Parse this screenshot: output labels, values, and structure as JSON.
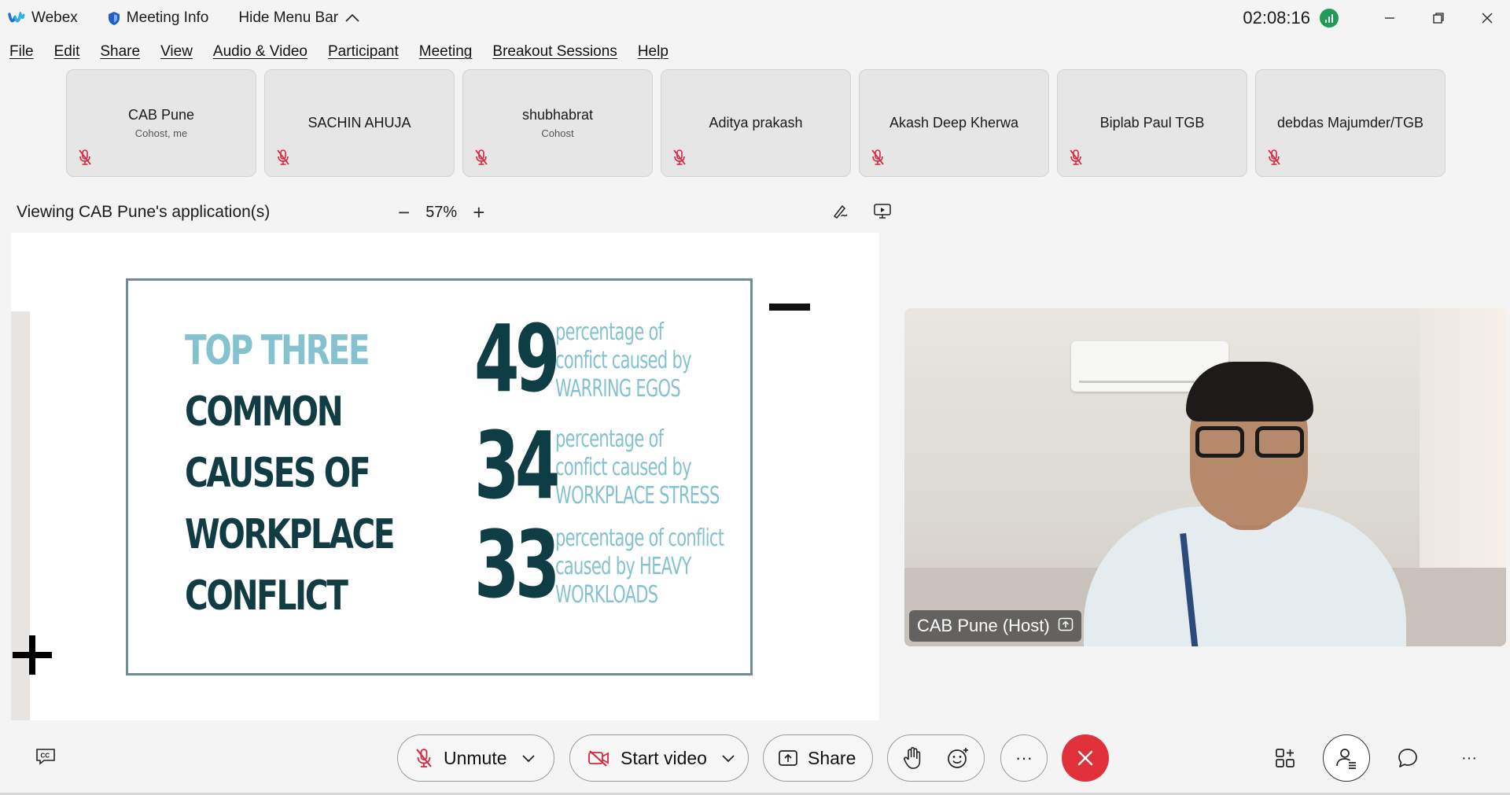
{
  "titlebar": {
    "app_name": "Webex",
    "meeting_info": "Meeting Info",
    "hide_menu": "Hide Menu Bar",
    "time": "02:08:16"
  },
  "menu": [
    "File",
    "Edit",
    "Share",
    "View",
    "Audio & Video",
    "Participant",
    "Meeting",
    "Breakout Sessions",
    "Help"
  ],
  "participants": [
    {
      "name": "CAB Pune",
      "role": "Cohost, me"
    },
    {
      "name": "SACHIN AHUJA",
      "role": ""
    },
    {
      "name": "shubhabrat",
      "role": "Cohost"
    },
    {
      "name": "Aditya prakash",
      "role": ""
    },
    {
      "name": "Akash Deep Kherwa",
      "role": ""
    },
    {
      "name": "Biplab Paul TGB",
      "role": ""
    },
    {
      "name": "debdas Majumder/TGB",
      "role": ""
    }
  ],
  "share_view": {
    "title": "Viewing CAB Pune's application(s)",
    "zoom": "57%",
    "zoom_out": "−",
    "zoom_in": "+"
  },
  "slide": {
    "title_lines": [
      {
        "text": "TOP THREE",
        "tone": "light"
      },
      {
        "text": "COMMON",
        "tone": "dark"
      },
      {
        "text": "CAUSES OF",
        "tone": "dark"
      },
      {
        "text": "WORKPLACE",
        "tone": "dark"
      },
      {
        "text": "CONFLICT",
        "tone": "dark"
      }
    ],
    "stats": [
      {
        "value": "49",
        "lines": [
          "percentage of",
          "confict caused by",
          "WARRING EGOS"
        ]
      },
      {
        "value": "34",
        "lines": [
          "percentage of",
          "confict caused by",
          "WORKPLACE STRESS"
        ]
      },
      {
        "value": "33",
        "lines": [
          "percentage of conflict",
          "caused by HEAVY",
          "WORKLOADS"
        ]
      }
    ]
  },
  "video": {
    "label": "CAB Pune (Host)"
  },
  "controls": {
    "unmute": "Unmute",
    "start_video": "Start video",
    "share": "Share",
    "more": "···",
    "right_more": "···"
  },
  "colors": {
    "slide_dark": "#123c44",
    "slide_light": "#84c2d0",
    "end_call": "#e0313b",
    "mute_red": "#d7263d",
    "connection_green": "#1f9d55"
  }
}
